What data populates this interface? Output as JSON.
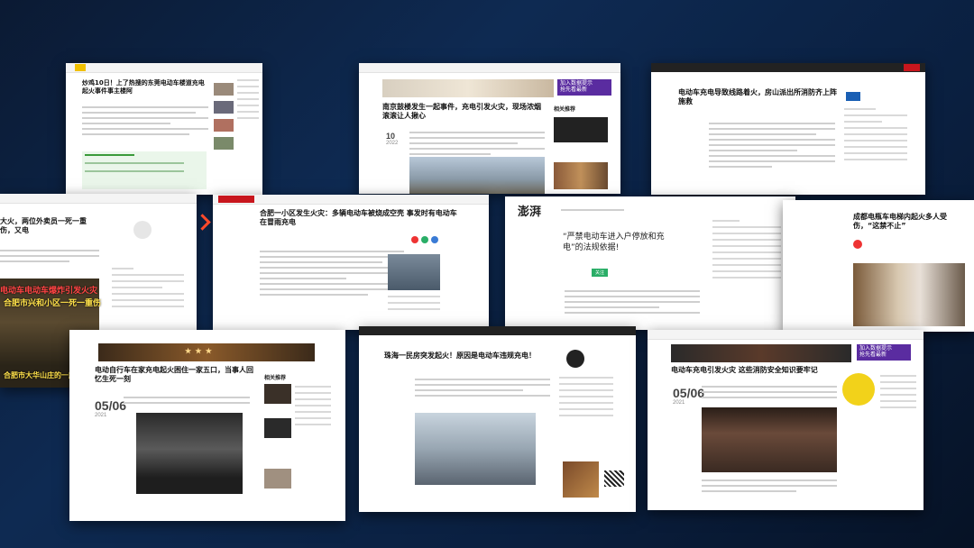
{
  "cards": {
    "a": {
      "title": "炒鸡10日！上了热搜的东莞电动车楼道充电起火事件事主楼阿"
    },
    "b": {
      "title": "南京鼓楼发生一起事件，充电引发火灾，现场浓烟滚滚让人揪心"
    },
    "c": {
      "title": "电动车充电导致线路着火，房山派出所消防齐上阵施救"
    },
    "d": {
      "title": "大火，两位外卖员一死一重伤，又电",
      "overlay1": "电动车电动车爆炸引发火灾",
      "overlay2": "合肥市兴和小区一死一重伤",
      "overlay3": "合肥市大华山庄的一起民房"
    },
    "e": {
      "title": "合肥一小区发生火灾：多辆电动车被烧成空壳 事发时有电动车在冒雨充电"
    },
    "f": {
      "logo": "澎湃",
      "quote": "“严禁电动车进入户停放和充电”的法规依据!"
    },
    "g": {
      "title": "成都电瓶车电梯内起火多人受伤，“这禁不止”"
    },
    "h": {
      "title": "电动自行车在家充电起火困住一家五口，当事人回忆生死一刻",
      "date_day": "05/06",
      "date_year": "2021"
    },
    "i": {
      "title": "珠海一民房突发起火！原因是电动车违规充电！"
    },
    "j": {
      "title": "电动车充电引发火灾 这些消防安全知识要牢记",
      "date_day": "05/06",
      "date_year": "2021"
    }
  },
  "colors": {
    "bg": "#0b1a33",
    "accent_red": "#c8161d",
    "promo_purple": "#5a2ca0"
  }
}
